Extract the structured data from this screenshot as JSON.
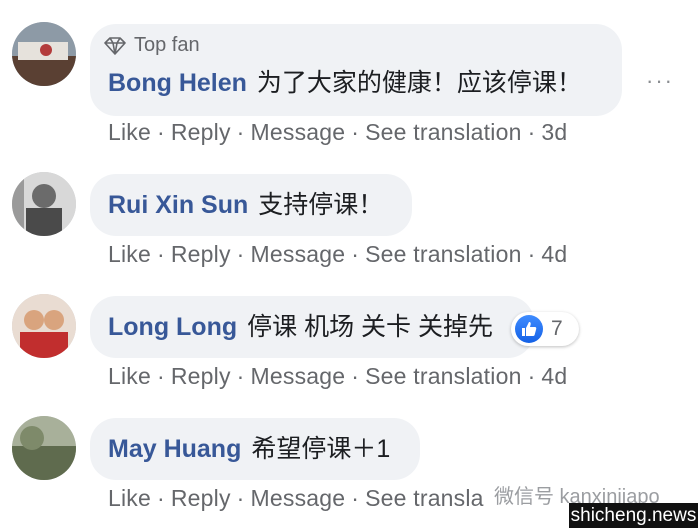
{
  "comments": [
    {
      "badge": "Top fan",
      "author": "Bong Helen",
      "text": "为了大家的健康！应该停课！",
      "actions": [
        "Like",
        "Reply",
        "Message",
        "See translation",
        "3d"
      ]
    },
    {
      "author": "Rui Xin Sun",
      "text": "支持停课！",
      "actions": [
        "Like",
        "Reply",
        "Message",
        "See translation",
        "4d"
      ]
    },
    {
      "author": "Long Long",
      "text": "停课 机场 关卡 关掉先",
      "reaction_count": "7",
      "actions": [
        "Like",
        "Reply",
        "Message",
        "See translation",
        "4d"
      ]
    },
    {
      "author": "May Huang",
      "text": "希望停课＋1",
      "actions": [
        "Like",
        "Reply",
        "Message",
        "See transla"
      ]
    }
  ],
  "more_options": "···",
  "watermark": "微信号 kanxinjiapo",
  "site_badge": "shicheng.news",
  "colors": {
    "author": "#385898",
    "bubble": "#f0f2f5",
    "meta": "#65676b",
    "like": "#1877f2"
  }
}
